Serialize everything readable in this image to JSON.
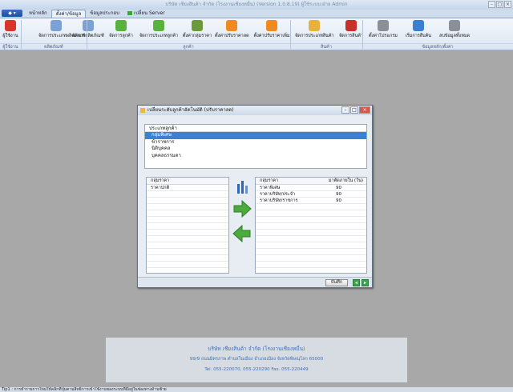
{
  "window": {
    "title": "บริษัท เชียงสินค้า จำกัด (โรงงานเชียงหมื่น) (Version 1.0.8.19) ผู้ใช้ระบบ:ฝ่าย Admin"
  },
  "tabs": [
    "หน้าหลัก",
    "ตั้งค่า/ข้อมูล",
    "ข้อมูลประกอบ",
    "เปลี่ยน Server"
  ],
  "ribbon": {
    "buttons": [
      {
        "label": "ผู้ใช้งาน",
        "icon": "user-icon",
        "color": "#d9352b"
      },
      {
        "label": "จัดการประเภทผลิตภัณฑ์",
        "icon": "product-type-icon",
        "color": "#7aa2d6"
      },
      {
        "label": "จัดการผลิตภัณฑ์",
        "icon": "product-icon",
        "color": "#7aa2d6"
      },
      {
        "label": "จัดการลูกค้า",
        "icon": "customer-icon",
        "color": "#58b23e"
      },
      {
        "label": "จัดการประเภทลูกค้า",
        "icon": "customer-type-icon",
        "color": "#58b23e"
      },
      {
        "label": "ตั้งค่ากลุ่มราคา",
        "icon": "price-group-icon",
        "color": "#6c9a3a"
      },
      {
        "label": "ตั้งค่าปรับราคาลด",
        "icon": "price-down-icon",
        "color": "#f08a1e"
      },
      {
        "label": "ตั้งค่าปรับราคาเพิ่ม",
        "icon": "price-up-icon",
        "color": "#f08a1e"
      },
      {
        "label": "จัดการประเภทสินค้า",
        "icon": "goods-type-icon",
        "color": "#e8b23a"
      },
      {
        "label": "จัดการสินค้า",
        "icon": "goods-icon",
        "color": "#c8302a"
      },
      {
        "label": "ตั้งค่าโปรแกรม",
        "icon": "settings-icon",
        "color": "#8a8f98"
      },
      {
        "label": "เริ่มการสืบค้น",
        "icon": "search-globe-icon",
        "color": "#3a7fd0"
      },
      {
        "label": "ลบข้อมูลทั้งหมด",
        "icon": "delete-data-icon",
        "color": "#8a8f98"
      }
    ],
    "groups": [
      "ผู้ใช้งาน",
      "ผลิตภัณฑ์",
      "ลูกค้า",
      "สินค้า",
      "ข้อมูลหลัก/ตั้งค่า"
    ]
  },
  "dialog": {
    "title": "เปลี่ยนระดับลูกค้าอัตโนมัติ (ปรับราคาลด)",
    "customer_type_header": "ประเภทลูกค้า",
    "customer_types": [
      "กลุ่มพิเศษ",
      "ข้าราชการ",
      "นิติบุคคล",
      "บุคคลธรรมดา"
    ],
    "selected_type_index": 0,
    "left_header": "กลุ่มราคา",
    "left_items": [
      "ราคาปกติ"
    ],
    "right_header_1": "กลุ่มราคา",
    "right_header_2": "มาตัดภายใน (วัน)",
    "right_rows": [
      [
        "ราคาพิเศษ",
        "90"
      ],
      [
        "ราคาบริษัท/ประจำ",
        "90"
      ],
      [
        "ราคาบริษัท/ราชการ",
        "90"
      ]
    ],
    "save_label": "บันทึก"
  },
  "banner": {
    "line1": "บริษัท เชียงสินค้า จำกัด (โรงงานเชียงหมื่น)",
    "line2": "99/9 ถนนมิตรภาพ ตำบลในเมือง อำเภอเมือง จังหวัดพิษณุโลก 65000",
    "line3": "Tel. 055-220070, 055-220290 Fax. 055-220449"
  },
  "status": "Tip1 : การทำรายการใหม่ให้คลิกที่ปุ่มตามสิทธิ์การเข้าใช้งานของระบบที่มีอยู่ในช่องทางด้านซ้าย"
}
